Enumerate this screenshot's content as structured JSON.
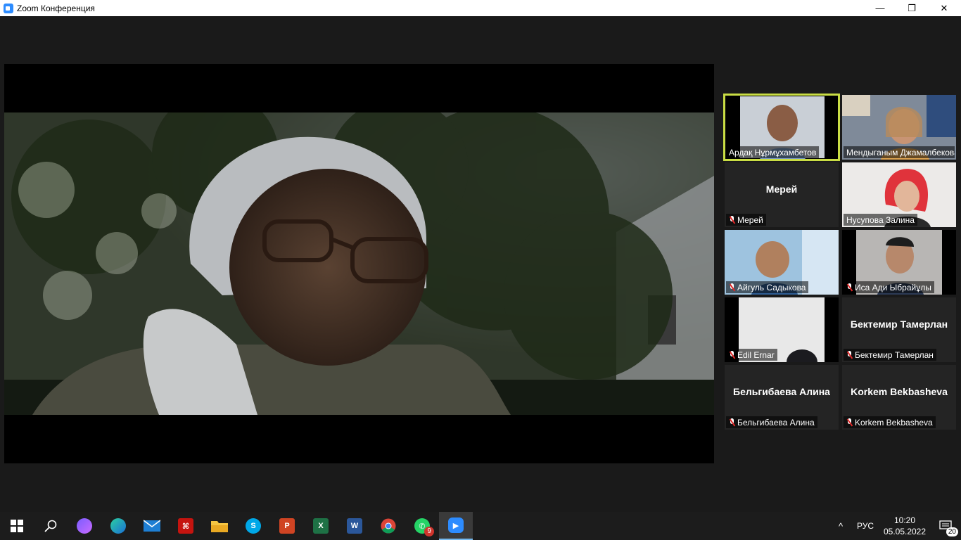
{
  "window": {
    "title": "Zoom Конференция",
    "minimize_glyph": "—",
    "restore_glyph": "❐",
    "close_glyph": "✕"
  },
  "participants": [
    {
      "name": "Ардақ Нұрмұхамбетов",
      "video": true,
      "muted": false,
      "active": true
    },
    {
      "name": "Мендыганым Джамалбекова",
      "video": true,
      "muted": false,
      "active": false
    },
    {
      "name": "Мерей",
      "display": "Мерей",
      "video": false,
      "muted": true
    },
    {
      "name": "Нусупова Залина",
      "video": true,
      "muted": false
    },
    {
      "name": "Айгуль Садыкова",
      "video": true,
      "muted": true
    },
    {
      "name": "Иса Ади Ыбрайұлы",
      "video": true,
      "muted": true
    },
    {
      "name": "Edil Ernar",
      "video": true,
      "muted": true
    },
    {
      "name": "Бектемир Тамерлан",
      "display": "Бектемир Тамерлан",
      "video": false,
      "muted": true
    },
    {
      "name": "Бельгибаева Алина",
      "display": "Бельгибаева Алина",
      "video": false,
      "muted": true
    },
    {
      "name": "Korkem Bekbasheva",
      "display": "Korkem Bekbasheva",
      "video": false,
      "muted": true
    }
  ],
  "taskbar": {
    "items": [
      {
        "name": "start",
        "icon": "windows-logo-icon"
      },
      {
        "name": "search",
        "icon": "search-icon"
      },
      {
        "name": "alice",
        "icon": "alice-icon"
      },
      {
        "name": "edge",
        "icon": "edge-icon"
      },
      {
        "name": "mail",
        "icon": "mail-icon"
      },
      {
        "name": "acrobat",
        "icon": "acrobat-icon"
      },
      {
        "name": "explorer",
        "icon": "folder-icon"
      },
      {
        "name": "skype",
        "icon": "skype-icon"
      },
      {
        "name": "powerpoint",
        "icon": "powerpoint-icon"
      },
      {
        "name": "excel",
        "icon": "excel-icon"
      },
      {
        "name": "word",
        "icon": "word-icon"
      },
      {
        "name": "chrome",
        "icon": "chrome-icon"
      },
      {
        "name": "whatsapp",
        "icon": "whatsapp-icon",
        "badge": "9"
      },
      {
        "name": "zoom",
        "icon": "zoom-icon",
        "active": true
      }
    ],
    "tray": {
      "chevron": "^",
      "language": "РУС",
      "time": "10:20",
      "date": "05.05.2022",
      "notifications_count": "20"
    }
  },
  "colors": {
    "active_speaker_border": "#c9dd44",
    "zoom_blue": "#2D8CFF",
    "mute_red": "#e02828"
  }
}
